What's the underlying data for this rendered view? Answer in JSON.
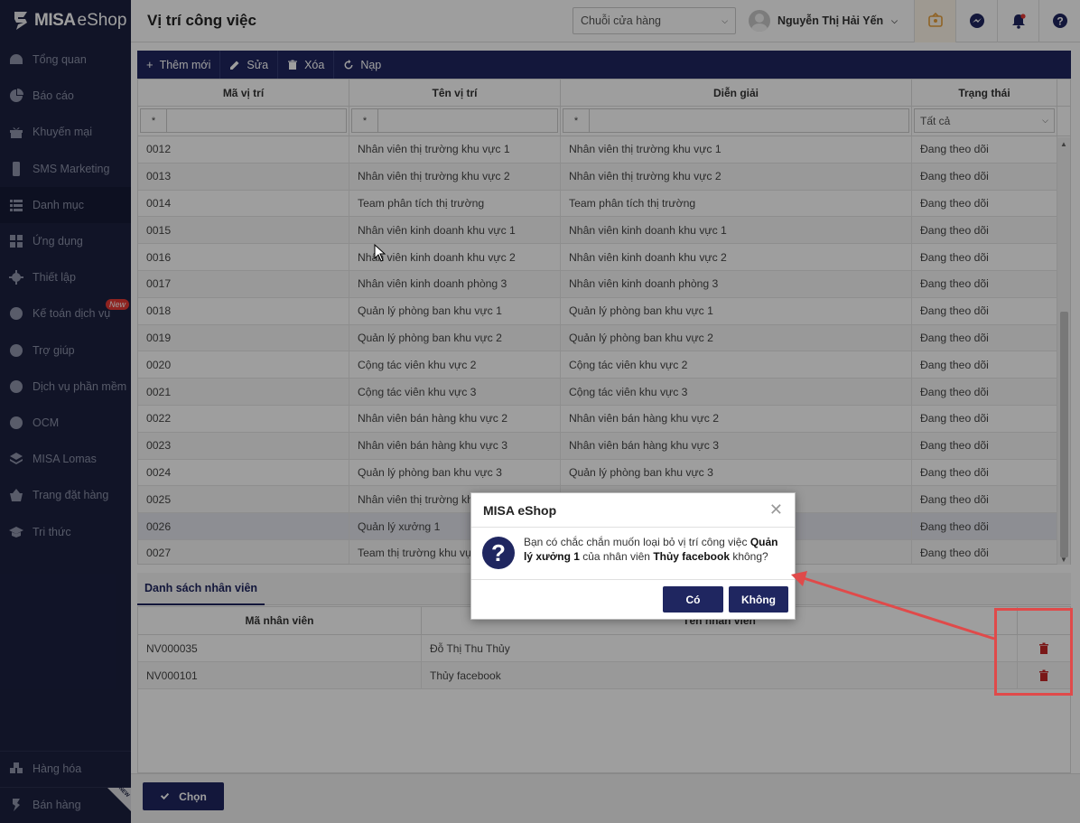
{
  "app": {
    "logo_bold": "MISA",
    "logo_light": "eShop"
  },
  "sidebar": {
    "items": [
      {
        "label": "Tổng quan",
        "icon": "dashboard-icon"
      },
      {
        "label": "Báo cáo",
        "icon": "pie-chart-icon"
      },
      {
        "label": "Khuyến mại",
        "icon": "gift-icon"
      },
      {
        "label": "SMS Marketing",
        "icon": "phone-icon"
      },
      {
        "label": "Danh mục",
        "icon": "list-icon"
      },
      {
        "label": "Ứng dụng",
        "icon": "apps-icon"
      },
      {
        "label": "Thiết lập",
        "icon": "gear-icon"
      },
      {
        "label": "Kế toán dịch vụ",
        "icon": "accounting-icon",
        "badge": "New"
      },
      {
        "label": "Trợ giúp",
        "icon": "help-icon"
      },
      {
        "label": "Dịch vụ phần mềm",
        "icon": "user-icon"
      },
      {
        "label": "OCM",
        "icon": "ocm-icon"
      },
      {
        "label": "MISA Lomas",
        "icon": "layers-icon"
      },
      {
        "label": "Trang đặt hàng",
        "icon": "basket-icon"
      },
      {
        "label": "Tri thức",
        "icon": "graduation-icon"
      }
    ],
    "bottom": [
      {
        "label": "Hàng hóa",
        "icon": "goods-icon"
      },
      {
        "label": "Bán hàng",
        "icon": "sales-icon",
        "corner_badge": "NEW"
      }
    ]
  },
  "header": {
    "title": "Vị trí công việc",
    "store_select": "Chuỗi cửa hàng",
    "user_name": "Nguyễn Thị Hải Yến"
  },
  "toolbar": {
    "add": "Thêm mới",
    "edit": "Sửa",
    "delete": "Xóa",
    "reload": "Nạp"
  },
  "grid": {
    "columns": [
      "Mã vị trí",
      "Tên vị trí",
      "Diễn giải",
      "Trạng thái"
    ],
    "filter_op": "*",
    "status_filter": "Tất cả",
    "rows": [
      [
        "0012",
        "Nhân viên thị trường khu vực 1",
        "Nhân viên thị trường khu vực 1",
        "Đang theo dõi"
      ],
      [
        "0013",
        "Nhân viên thị trường khu vực 2",
        "Nhân viên thị trường khu vực 2",
        "Đang theo dõi"
      ],
      [
        "0014",
        "Team phân tích thị trường",
        "Team phân tích thị trường",
        "Đang theo dõi"
      ],
      [
        "0015",
        "Nhân viên kinh doanh khu vực 1",
        "Nhân viên kinh doanh khu vực 1",
        "Đang theo dõi"
      ],
      [
        "0016",
        "Nhân viên kinh doanh khu vực 2",
        "Nhân viên kinh doanh khu vực 2",
        "Đang theo dõi"
      ],
      [
        "0017",
        "Nhân viên kinh doanh phòng 3",
        "Nhân viên kinh doanh phòng 3",
        "Đang theo dõi"
      ],
      [
        "0018",
        "Quản lý phòng ban khu vực 1",
        "Quản lý phòng ban khu vực 1",
        "Đang theo dõi"
      ],
      [
        "0019",
        "Quản lý phòng ban khu vực 2",
        "Quản lý phòng ban khu vực 2",
        "Đang theo dõi"
      ],
      [
        "0020",
        "Cộng tác viên khu vực 2",
        "Cộng tác viên khu vực 2",
        "Đang theo dõi"
      ],
      [
        "0021",
        "Cộng tác viên khu vực 3",
        "Cộng tác viên khu vực 3",
        "Đang theo dõi"
      ],
      [
        "0022",
        "Nhân viên bán hàng khu vực 2",
        "Nhân viên bán hàng khu vực 2",
        "Đang theo dõi"
      ],
      [
        "0023",
        "Nhân viên bán hàng khu vực 3",
        "Nhân viên bán hàng khu vực 3",
        "Đang theo dõi"
      ],
      [
        "0024",
        "Quản lý phòng ban khu vực 3",
        "Quản lý phòng ban khu vực 3",
        "Đang theo dõi"
      ],
      [
        "0025",
        "Nhân viên thị trường khu vực 3",
        "",
        "Đang theo dõi"
      ],
      [
        "0026",
        "Quản lý xưởng 1",
        "",
        "Đang theo dõi"
      ],
      [
        "0027",
        "Team thị trường khu vực 4",
        "",
        "Đang theo dõi"
      ]
    ],
    "selected_index": 14
  },
  "employees": {
    "tab": "Danh sách nhân viên",
    "columns": [
      "Mã nhân viên",
      "Tên nhân viên"
    ],
    "rows": [
      [
        "NV000035",
        "Đỗ Thị Thu Thủy"
      ],
      [
        "NV000101",
        "Thủy facebook"
      ]
    ]
  },
  "footer": {
    "choose": "Chọn"
  },
  "dialog": {
    "title": "MISA eShop",
    "msg_1": "Bạn có chắc chắn muốn loại bỏ vị trí công việc ",
    "msg_position": "Quản lý xưởng 1",
    "msg_2": " của nhân viên ",
    "msg_employee": "Thủy facebook",
    "msg_3": " không?",
    "yes": "Có",
    "no": "Không"
  },
  "colors": {
    "sidebar": "#1c2140",
    "primary": "#1f2660",
    "annotation": "#e04a4a",
    "delete_icon": "#c62828"
  }
}
